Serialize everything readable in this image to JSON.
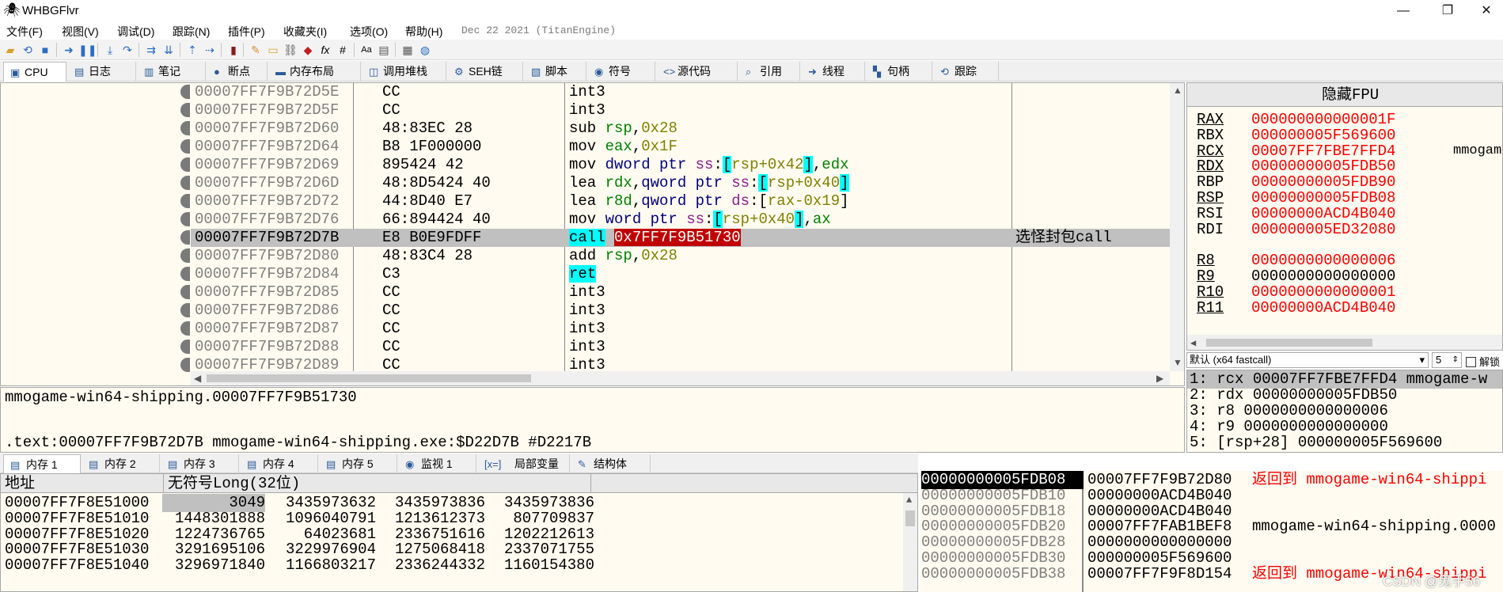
{
  "window": {
    "title": "WHBGFlvr",
    "min": "—",
    "max": "❐",
    "close": "✕"
  },
  "menu": {
    "items": [
      "文件(F)",
      "视图(V)",
      "调试(D)",
      "跟踪(N)",
      "插件(P)",
      "收藏夹(I)",
      "选项(O)",
      "帮助(H)"
    ],
    "date": "Dec 22 2021 (TitanEngine)"
  },
  "tabs": [
    {
      "icon": "▣",
      "label": "CPU"
    },
    {
      "icon": "▤",
      "label": "日志"
    },
    {
      "icon": "▥",
      "label": "笔记"
    },
    {
      "icon": "●",
      "label": "断点"
    },
    {
      "icon": "▬",
      "label": "内存布局"
    },
    {
      "icon": "◫",
      "label": "调用堆栈"
    },
    {
      "icon": "⚙",
      "label": "SEH链"
    },
    {
      "icon": "▧",
      "label": "脚本"
    },
    {
      "icon": "◉",
      "label": "符号"
    },
    {
      "icon": "<>",
      "label": "源代码"
    },
    {
      "icon": "⌕",
      "label": "引用"
    },
    {
      "icon": "➜",
      "label": "线程"
    },
    {
      "icon": "▚",
      "label": "句柄"
    },
    {
      "icon": "⟲",
      "label": "跟踪"
    }
  ],
  "disasm": {
    "rows": [
      {
        "addr": "00007FF7F9B72D5E",
        "bytes": "CC",
        "asm": [
          [
            "int3",
            "p"
          ]
        ],
        "comment": ""
      },
      {
        "addr": "00007FF7F9B72D5F",
        "bytes": "CC",
        "asm": [
          [
            "int3",
            "p"
          ]
        ],
        "comment": ""
      },
      {
        "addr": "00007FF7F9B72D60",
        "bytes": "48:83EC 28",
        "asm": [
          [
            "sub ",
            "p"
          ],
          [
            "rsp",
            "reg"
          ],
          [
            ",",
            "p"
          ],
          [
            "0x28",
            "num"
          ]
        ],
        "comment": ""
      },
      {
        "addr": "00007FF7F9B72D64",
        "bytes": "B8 1F000000",
        "asm": [
          [
            "mov ",
            "p"
          ],
          [
            "eax",
            "reg"
          ],
          [
            ",",
            "p"
          ],
          [
            "0x1F",
            "num"
          ]
        ],
        "comment": ""
      },
      {
        "addr": "00007FF7F9B72D69",
        "bytes": "895424 42",
        "asm": [
          [
            "mov ",
            "p"
          ],
          [
            "dword ptr ",
            "kw"
          ],
          [
            "ss",
            "ss"
          ],
          [
            ":",
            "p"
          ],
          [
            "[",
            "br"
          ],
          [
            "rsp+0x42",
            "num"
          ],
          [
            "]",
            "br"
          ],
          [
            ",",
            "p"
          ],
          [
            "edx",
            "reg"
          ]
        ],
        "comment": ""
      },
      {
        "addr": "00007FF7F9B72D6D",
        "bytes": "48:8D5424 40",
        "asm": [
          [
            "lea ",
            "p"
          ],
          [
            "rdx",
            "reg"
          ],
          [
            ",",
            "p"
          ],
          [
            "qword ptr ",
            "kw"
          ],
          [
            "ss",
            "ss"
          ],
          [
            ":",
            "p"
          ],
          [
            "[",
            "br"
          ],
          [
            "rsp+0x40",
            "num"
          ],
          [
            "]",
            "br"
          ]
        ],
        "comment": ""
      },
      {
        "addr": "00007FF7F9B72D72",
        "bytes": "44:8D40 E7",
        "asm": [
          [
            "lea ",
            "p"
          ],
          [
            "r8d",
            "reg"
          ],
          [
            ",",
            "p"
          ],
          [
            "qword ptr ",
            "kw"
          ],
          [
            "ds",
            "ss"
          ],
          [
            ":",
            "p"
          ],
          [
            "[",
            "p"
          ],
          [
            "rax-0x19",
            "num"
          ],
          [
            "]",
            "p"
          ]
        ],
        "comment": ""
      },
      {
        "addr": "00007FF7F9B72D76",
        "bytes": "66:894424 40",
        "asm": [
          [
            "mov ",
            "p"
          ],
          [
            "word ptr ",
            "kw"
          ],
          [
            "ss",
            "ss"
          ],
          [
            ":",
            "p"
          ],
          [
            "[",
            "br"
          ],
          [
            "rsp+0x40",
            "num"
          ],
          [
            "]",
            "br"
          ],
          [
            ",",
            "p"
          ],
          [
            "ax",
            "reg"
          ]
        ],
        "comment": ""
      },
      {
        "addr": "00007FF7F9B72D7B",
        "bytes": "E8 B0E9FDFF",
        "asm": [
          [
            "call",
            "cyan"
          ],
          [
            " ",
            "p"
          ],
          [
            "0x7FF7F9B51730",
            "red"
          ]
        ],
        "comment": "选怪封包call",
        "sel": true
      },
      {
        "addr": "00007FF7F9B72D80",
        "bytes": "48:83C4 28",
        "asm": [
          [
            "add ",
            "p"
          ],
          [
            "rsp",
            "reg"
          ],
          [
            ",",
            "p"
          ],
          [
            "0x28",
            "num"
          ]
        ],
        "comment": ""
      },
      {
        "addr": "00007FF7F9B72D84",
        "bytes": "C3",
        "asm": [
          [
            "ret",
            "cyan"
          ]
        ],
        "comment": ""
      },
      {
        "addr": "00007FF7F9B72D85",
        "bytes": "CC",
        "asm": [
          [
            "int3",
            "p"
          ]
        ],
        "comment": ""
      },
      {
        "addr": "00007FF7F9B72D86",
        "bytes": "CC",
        "asm": [
          [
            "int3",
            "p"
          ]
        ],
        "comment": ""
      },
      {
        "addr": "00007FF7F9B72D87",
        "bytes": "CC",
        "asm": [
          [
            "int3",
            "p"
          ]
        ],
        "comment": ""
      },
      {
        "addr": "00007FF7F9B72D88",
        "bytes": "CC",
        "asm": [
          [
            "int3",
            "p"
          ]
        ],
        "comment": ""
      },
      {
        "addr": "00007FF7F9B72D89",
        "bytes": "CC",
        "asm": [
          [
            "int3",
            "p"
          ]
        ],
        "comment": ""
      }
    ]
  },
  "regs": {
    "header": "隐藏FPU",
    "rows": [
      {
        "name": "RAX",
        "val": "000000000000001F",
        "u": true,
        "comment": ""
      },
      {
        "name": "RBX",
        "val": "000000005F569600",
        "u": false,
        "comment": ""
      },
      {
        "name": "RCX",
        "val": "00007FF7FBE7FFD4",
        "u": true,
        "comment": "mmogam"
      },
      {
        "name": "RDX",
        "val": "00000000005FDB50",
        "u": true,
        "comment": ""
      },
      {
        "name": "RBP",
        "val": "00000000005FDB90",
        "u": false,
        "comment": ""
      },
      {
        "name": "RSP",
        "val": "00000000005FDB08",
        "u": true,
        "comment": ""
      },
      {
        "name": "RSI",
        "val": "00000000ACD4B040",
        "u": false,
        "comment": ""
      },
      {
        "name": "RDI",
        "val": "000000005ED32080",
        "u": false,
        "comment": ""
      },
      {
        "name": "",
        "val": "",
        "u": false,
        "comment": ""
      },
      {
        "name": "R8",
        "val": "0000000000000006",
        "u": true,
        "comment": ""
      },
      {
        "name": "R9",
        "val": "0000000000000000",
        "u": true,
        "comment": "",
        "black": true
      },
      {
        "name": "R10",
        "val": "0000000000000001",
        "u": true,
        "comment": ""
      },
      {
        "name": "R11",
        "val": "00000000ACD4B040",
        "u": true,
        "comment": ""
      }
    ]
  },
  "callconv": {
    "selected": "默认 (x64 fastcall)",
    "count": "5",
    "lock_label": "解锁"
  },
  "args": [
    {
      "text": "1: rcx 00007FF7FBE7FFD4 mmogame-w",
      "sel": true
    },
    {
      "text": "2: rdx 00000000005FDB50"
    },
    {
      "text": "3: r8 0000000000000006"
    },
    {
      "text": "4: r9 0000000000000000"
    },
    {
      "text": "5: [rsp+28] 000000005F569600"
    }
  ],
  "info": {
    "line1": "mmogame-win64-shipping.00007FF7F9B51730",
    "line2": ".text:00007FF7F9B72D7B mmogame-win64-shipping.exe:$D22D7B #D2217B"
  },
  "memtabs": [
    {
      "icon": "▤",
      "label": "内存 1"
    },
    {
      "icon": "▤",
      "label": "内存 2"
    },
    {
      "icon": "▤",
      "label": "内存 3"
    },
    {
      "icon": "▤",
      "label": "内存 4"
    },
    {
      "icon": "▤",
      "label": "内存 5"
    },
    {
      "icon": "◉",
      "label": "监视 1"
    },
    {
      "icon": "[x=]",
      "label": "局部变量"
    },
    {
      "icon": "✎",
      "label": "结构体"
    }
  ],
  "dump": {
    "col_addr": "地址",
    "col_data": "无符号Long(32位)",
    "rows": [
      {
        "addr": "00007FF7F8E51000",
        "vals": [
          "3049",
          "3435973632",
          "3435973836",
          "3435973836"
        ]
      },
      {
        "addr": "00007FF7F8E51010",
        "vals": [
          "1448301888",
          "1096040791",
          "1213612373",
          "807709837"
        ]
      },
      {
        "addr": "00007FF7F8E51020",
        "vals": [
          "1224736765",
          "64023681",
          "2336751616",
          "1202212613"
        ]
      },
      {
        "addr": "00007FF7F8E51030",
        "vals": [
          "3291695106",
          "3229976904",
          "1275068418",
          "2337071755"
        ]
      },
      {
        "addr": "00007FF7F8E51040",
        "vals": [
          "3296971840",
          "1166803217",
          "2336244332",
          "1160154380"
        ]
      }
    ]
  },
  "stack": {
    "rows": [
      {
        "addr": "00000000005FDB08",
        "val": "00007FF7F9B72D80",
        "comment": "返回到 mmogame-win64-shippi",
        "red": true,
        "top": true
      },
      {
        "addr": "00000000005FDB10",
        "val": "00000000ACD4B040",
        "comment": ""
      },
      {
        "addr": "00000000005FDB18",
        "val": "00000000ACD4B040",
        "comment": ""
      },
      {
        "addr": "00000000005FDB20",
        "val": "00007FF7FAB1BEF8",
        "comment": "mmogame-win64-shipping.0000"
      },
      {
        "addr": "00000000005FDB28",
        "val": "0000000000000000",
        "comment": ""
      },
      {
        "addr": "00000000005FDB30",
        "val": "000000005F569600",
        "comment": ""
      },
      {
        "addr": "00000000005FDB38",
        "val": "00007FF7F9F8D154",
        "comment": "返回到 mmogame-win64-shippi",
        "red": true
      }
    ]
  },
  "watermark": "CSDN @鬼手56",
  "colors": {
    "background": "#fffbf0",
    "red": "#ff0000",
    "cyan": "#00ffff",
    "selected": "#c0c0c0"
  }
}
